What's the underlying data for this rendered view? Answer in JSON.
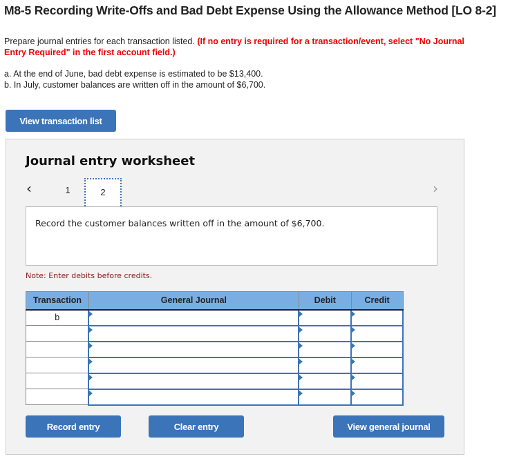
{
  "title": "M8-5 Recording Write-Offs and Bad Debt Expense Using the Allowance Method [LO 8-2]",
  "instructions": {
    "text": "Prepare journal entries for each transaction listed. ",
    "red": "(If no entry is required for a transaction/event, select \"No Journal Entry Required\" in the first account field.)"
  },
  "items": [
    "a. At the end of June, bad debt expense is estimated to be $13,400.",
    "b. In July, customer balances are written off in the amount of $6,700."
  ],
  "view_transaction_list": "View transaction list",
  "worksheet": {
    "heading": "Journal entry worksheet",
    "tabs": [
      "1",
      "2"
    ],
    "active_tab": "2",
    "description": "Record the customer balances written off in the amount of $6,700.",
    "note": "Note: Enter debits before credits.",
    "columns": [
      "Transaction",
      "General Journal",
      "Debit",
      "Credit"
    ],
    "rows": [
      {
        "transaction": "b"
      },
      {
        "transaction": ""
      },
      {
        "transaction": ""
      },
      {
        "transaction": ""
      },
      {
        "transaction": ""
      },
      {
        "transaction": ""
      }
    ],
    "buttons": {
      "record": "Record entry",
      "clear": "Clear entry",
      "view_journal": "View general journal"
    }
  }
}
